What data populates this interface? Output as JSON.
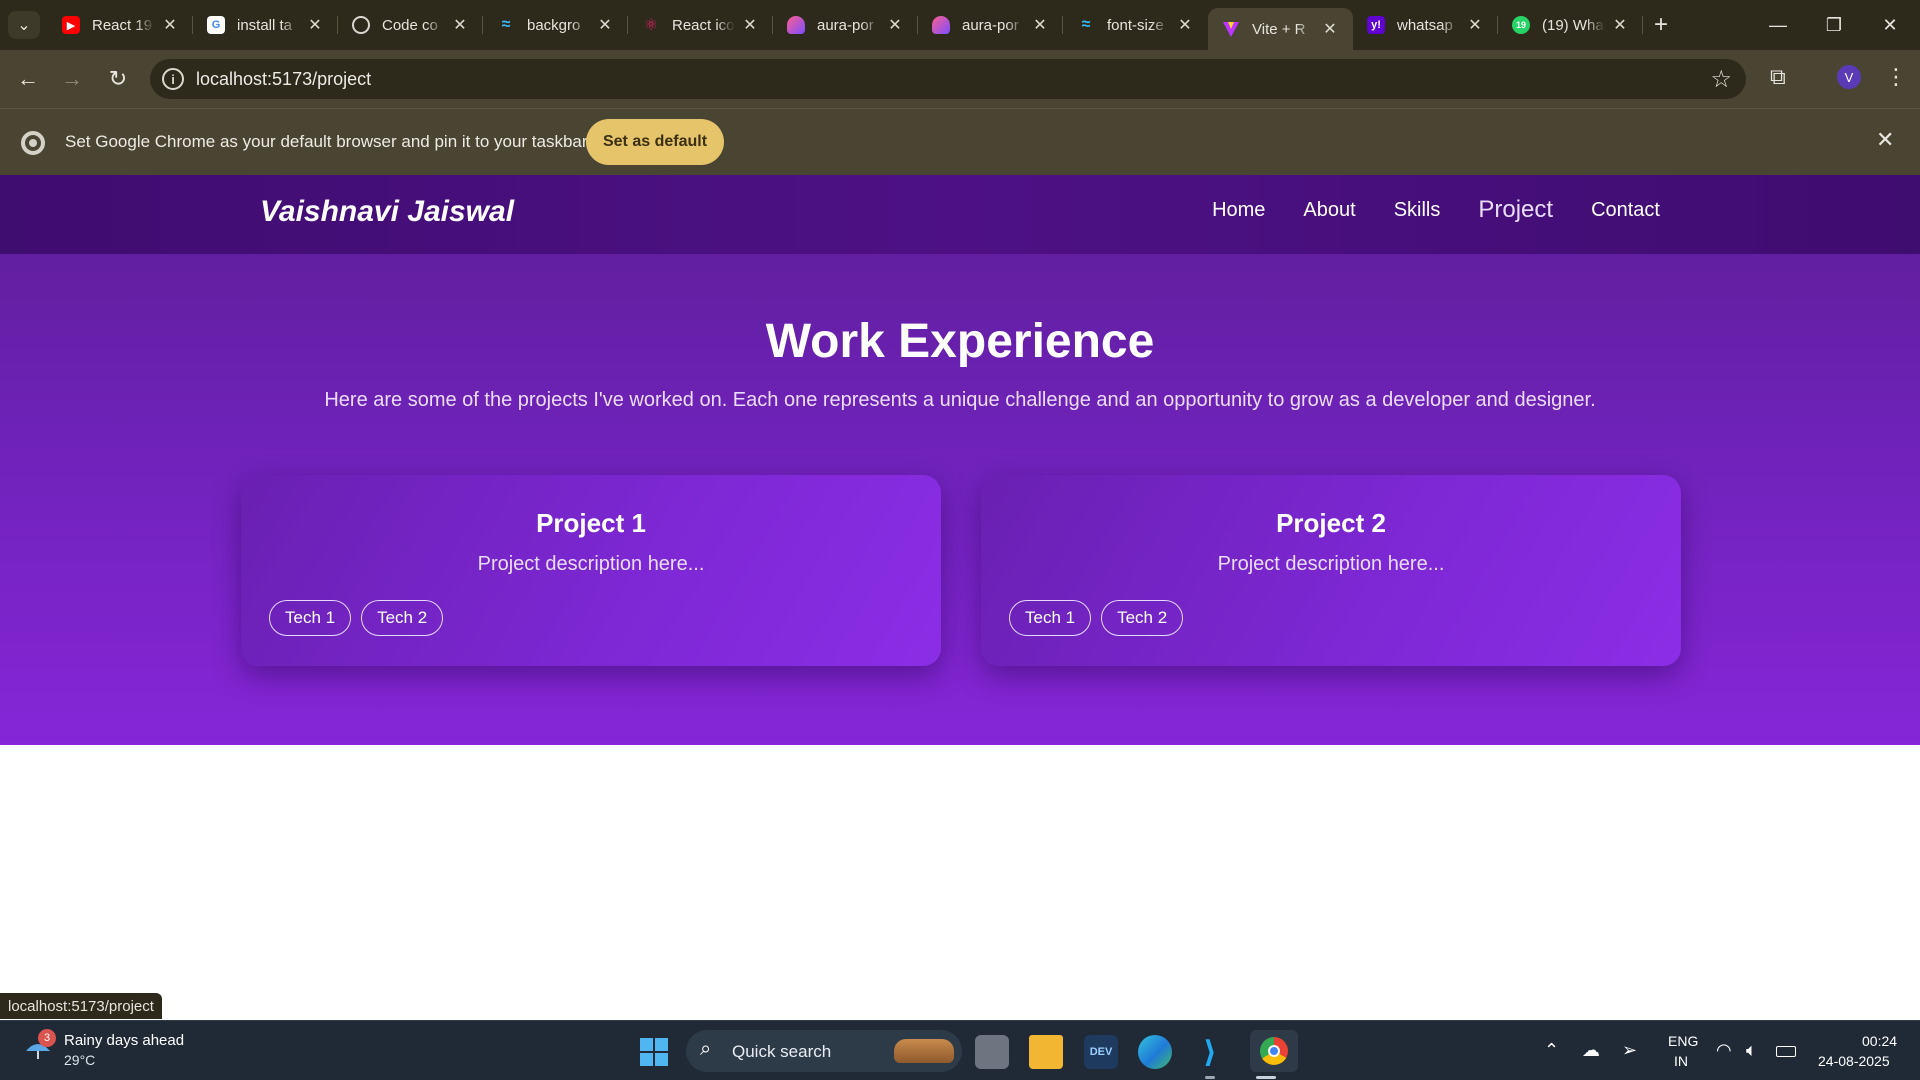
{
  "browser": {
    "tabs": [
      {
        "title": "React 19",
        "favicon": "youtube-icon",
        "color": "#ff0000"
      },
      {
        "title": "install ta",
        "favicon": "google-icon",
        "color": "#4285f4"
      },
      {
        "title": "Code co",
        "favicon": "chatgpt-icon",
        "color": "#9a9a9a"
      },
      {
        "title": "backgro",
        "favicon": "tailwind-icon",
        "color": "#38bdf8"
      },
      {
        "title": "React ico",
        "favicon": "react-icons-icon",
        "color": "#e91e63"
      },
      {
        "title": "aura-por",
        "favicon": "aura-icon",
        "color": "#e94e9c"
      },
      {
        "title": "aura-por",
        "favicon": "aura-icon",
        "color": "#e94e9c"
      },
      {
        "title": "font-size",
        "favicon": "tailwind-icon",
        "color": "#38bdf8"
      },
      {
        "title": "Vite + R",
        "favicon": "vite-icon",
        "color": "#bd34fe"
      },
      {
        "title": "whatsap",
        "favicon": "yahoo-icon",
        "color": "#6001d2"
      },
      {
        "title": "(19) Wha",
        "favicon": "whatsapp-icon",
        "color": "#25d366"
      }
    ],
    "active_tab": 8,
    "url": "localhost:5173/project",
    "profile_initial": "V",
    "infobar": {
      "text": "Set Google Chrome as your default browser and pin it to your taskbar",
      "button": "Set as default"
    },
    "status_url": "localhost:5173/project"
  },
  "site": {
    "brand": "Vaishnavi Jaiswal",
    "nav": [
      "Home",
      "About",
      "Skills",
      "Project",
      "Contact"
    ],
    "current_nav": "Project",
    "section_title": "Work Experience",
    "section_subtitle": "Here are some of the projects I've worked on. Each one represents a unique challenge and an opportunity to grow as a developer and designer.",
    "projects": [
      {
        "title": "Project 1",
        "description": "Project description here...",
        "tags": [
          "Tech 1",
          "Tech 2"
        ]
      },
      {
        "title": "Project 2",
        "description": "Project description here...",
        "tags": [
          "Tech 1",
          "Tech 2"
        ]
      }
    ]
  },
  "taskbar": {
    "weather": {
      "badge": "3",
      "title": "Rainy days ahead",
      "temp": "29°C"
    },
    "search_placeholder": "Quick search",
    "lang_line1": "ENG",
    "lang_line2": "IN",
    "time": "00:24",
    "date": "24-08-2025"
  },
  "colors": {
    "page_top": "#5d1d95",
    "page_bottom": "#8526d8",
    "nav_bar": "#3f0c70",
    "default_button": "#e6c56a"
  }
}
